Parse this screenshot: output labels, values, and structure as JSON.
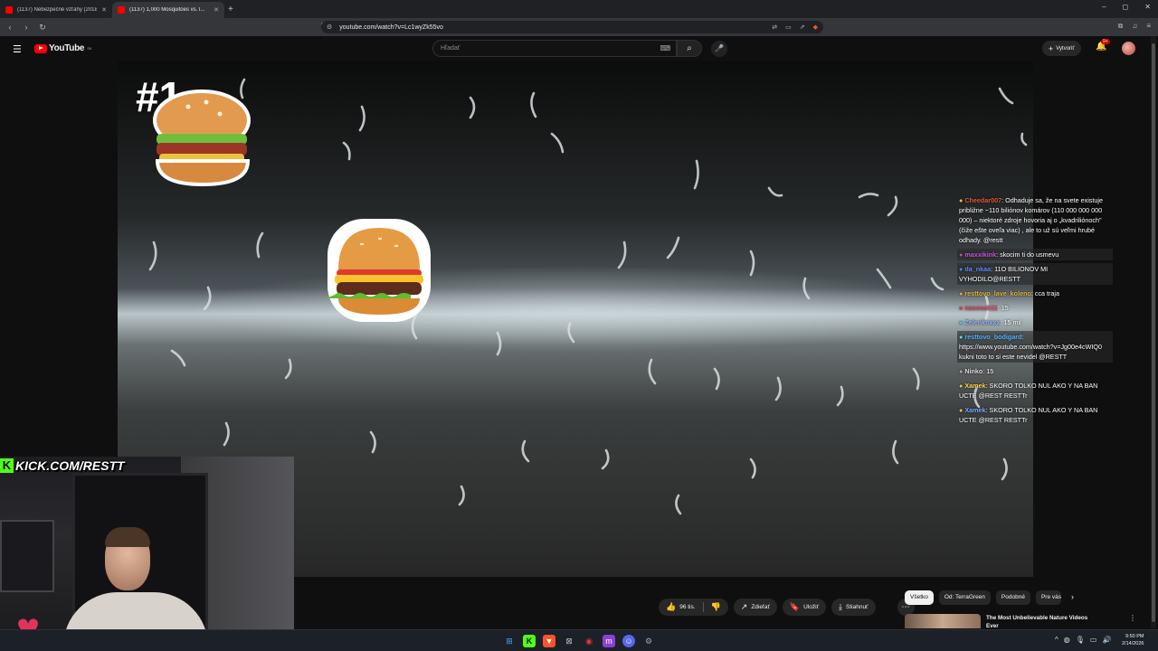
{
  "browser": {
    "tabs": [
      {
        "title": "(1137) Nebezpečné vzťahy (2018/10..."
      },
      {
        "title": "(1137) 1,000 Mosquitoes vs. I..."
      }
    ],
    "new_tab": "+",
    "window_controls": [
      "–",
      "◻",
      "✕"
    ],
    "url": "youtube.com/watch?v=Lc1wyZk55vo"
  },
  "youtube": {
    "logo": "YouTube",
    "region": "SK",
    "search_placeholder": "Hľadať",
    "create_label": "Vytvoriť",
    "notif_count": "9+"
  },
  "video": {
    "overlay_number": "#1"
  },
  "webcam": {
    "kick_text": "KICK.COM/RESTT"
  },
  "chat": [
    {
      "user": "Cheedar007",
      "text": "Odhaduje sa, že na svete existuje približne ~110 biliónov komárov (110 000 000 000 000) – niektoré zdroje hovoria aj o „kvadriliónoch\" (čiže ešte oveľa viac) , ale to už sú veľmi hrubé odhady. @restt",
      "boxed": false
    },
    {
      "user": "maxxikink",
      "text": "skocim ti do usmevu",
      "boxed": true
    },
    {
      "user": "da_nkaa",
      "text": "11O BILIONOV MI VYHODILO@RESTT",
      "boxed": true
    },
    {
      "user": "resttovo_lave_koleno",
      "text": "cca traja",
      "boxed": false
    },
    {
      "user": "nasosak11",
      "text": "15",
      "boxed": false
    },
    {
      "user": "Zelenkoxxx",
      "text": "15 mil",
      "boxed": false
    },
    {
      "user": "resttovo_bodigard",
      "text": "https://www.youtube.com/watch?v=Jg00e4cWIQ0 kukni toto to si este nevidel @RESTT",
      "boxed": true
    },
    {
      "user": "Ninko",
      "text": "15",
      "boxed": false
    },
    {
      "user": "Xamek",
      "text": "SKORO TOLKO NUL AKO Y NA BAN UCTE @REST RESTTr",
      "boxed": false
    },
    {
      "user": "Xamek",
      "text": "SKORO TOLKO NUL AKO Y NA BAN UCTE @REST RESTTr",
      "boxed": false
    }
  ],
  "actions": {
    "likes": "96 tis.",
    "share": "Zdieľať",
    "save": "Uložiť",
    "download": "Stiahnuť"
  },
  "chips": [
    "Všetko",
    "Od: TerraGreen",
    "Podobné",
    "Pre vás"
  ],
  "recommended": {
    "title": "The Most Unbelievable Nature Videos Ever"
  },
  "taskbar": {
    "time": "9:50 PM",
    "date": "2/14/2026"
  },
  "colors": {
    "yt_red": "#ff0000",
    "kick_green": "#53fc18",
    "background": "#0f0f0f"
  }
}
